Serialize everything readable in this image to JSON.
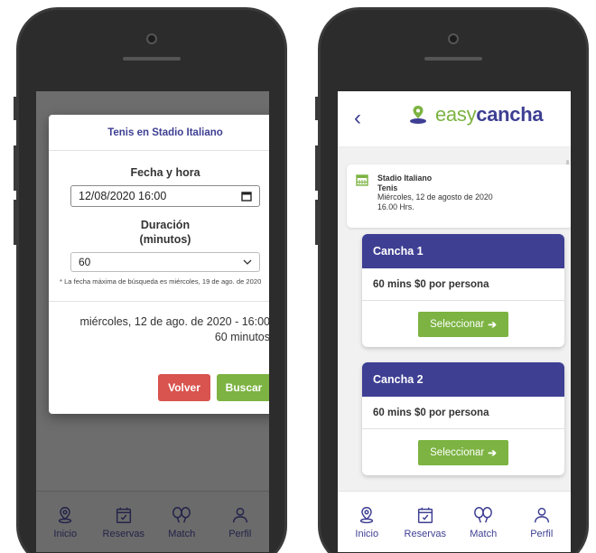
{
  "left_screen": {
    "modal": {
      "title": "Tenis en Stadio Italiano",
      "datetime_label": "Fecha y hora",
      "datetime_value": "12/08/2020 16:00",
      "duration_label_line1": "Duración",
      "duration_label_line2": "(minutos)",
      "duration_value": "60",
      "hint": "* La fecha máxima de búsqueda es miércoles, 19 de ago. de 2020",
      "summary_line1": "miércoles, 12 de ago. de 2020 - 16:00",
      "summary_line2": "60 minutos",
      "back_label": "Volver",
      "search_label": "Buscar"
    }
  },
  "right_screen": {
    "header": {
      "logo_easy": "easy",
      "logo_cancha": "cancha"
    },
    "info": {
      "venue": "Stadio Italiano",
      "sport": "Tenis",
      "date": "Miércoles, 12 de agosto de 2020",
      "time": "16.00 Hrs."
    },
    "courts": [
      {
        "name": "Cancha 1",
        "price": "60 mins $0 por persona",
        "select_label": "Seleccionar"
      },
      {
        "name": "Cancha 2",
        "price": "60 mins $0 por persona",
        "select_label": "Seleccionar"
      }
    ]
  },
  "nav": {
    "items": [
      {
        "label": "Inicio",
        "icon": "location-pin-icon"
      },
      {
        "label": "Reservas",
        "icon": "calendar-check-icon"
      },
      {
        "label": "Match",
        "icon": "tennis-racket-icon"
      },
      {
        "label": "Perfil",
        "icon": "user-icon"
      }
    ]
  },
  "colors": {
    "brand_purple": "#3e3f93",
    "brand_green": "#7cb342",
    "danger_red": "#d9534f"
  }
}
